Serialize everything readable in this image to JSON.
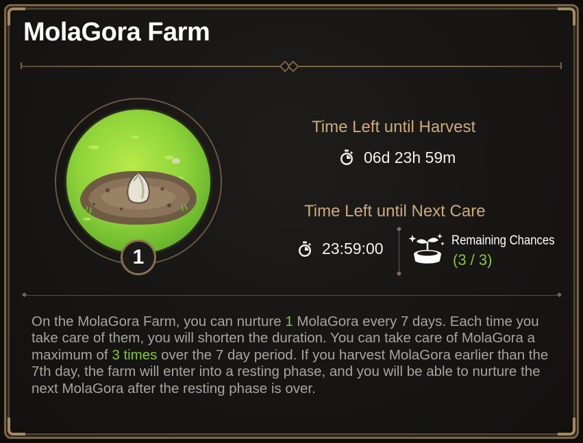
{
  "title": "MolaGora Farm",
  "farm": {
    "level": "1",
    "image": "sprouting-seed-in-soil-mound"
  },
  "harvest": {
    "label": "Time Left until Harvest",
    "icon": "stopwatch-icon",
    "time": "06d 23h 59m"
  },
  "care": {
    "label": "Time Left until Next Care",
    "icon": "stopwatch-icon",
    "time": "23:59:00",
    "care_icon": "sprout-pot-icon",
    "remaining_label": "Remaining Chances",
    "remaining_value": "(3 / 3)"
  },
  "description": {
    "p1": "On the MolaGora Farm, you can nurture ",
    "h1": "1",
    "p2": " MolaGora every 7 days. Each time you take care of them, you will shorten the duration. You can take care of MolaGora a maximum of ",
    "h2": "3 times",
    "p3": " over the 7 day period. If you harvest MolaGora earlier than the 7th day, the farm will enter into a resting phase, and you will be able to nurture the next MolaGora after the resting phase is over."
  },
  "colors": {
    "accent_gold": "#cfa97a",
    "highlight_green": "#86c63a",
    "frame": "#7a6548",
    "background": "#161514"
  }
}
